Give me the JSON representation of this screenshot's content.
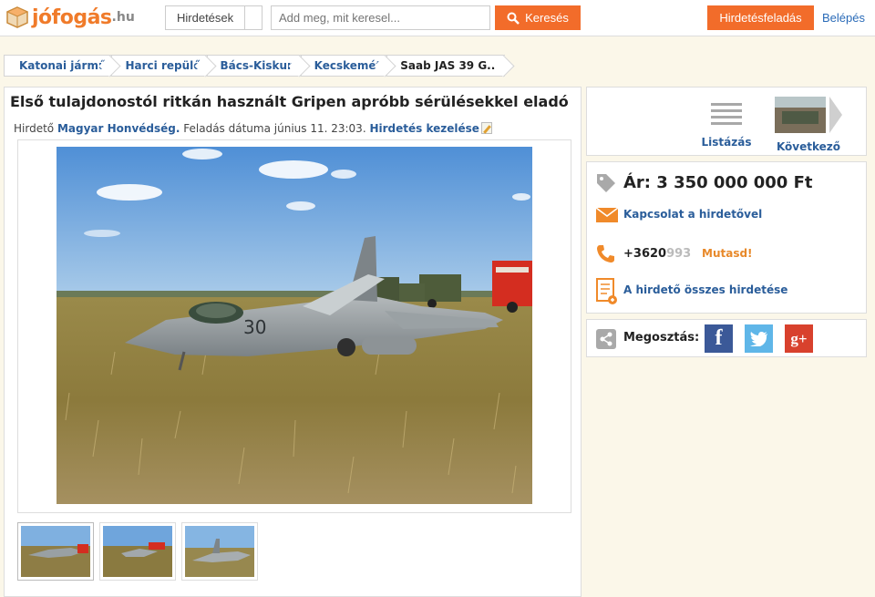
{
  "header": {
    "logo_text": "jófogás",
    "logo_tld": ".hu",
    "category_select": "Hirdetések",
    "search_placeholder": "Add meg, mit keresel...",
    "search_button": "Keresés",
    "post_button": "Hirdetésfeladás",
    "login_link": "Belépés"
  },
  "breadcrumb": [
    "Katonai jármű",
    "Harci repülő",
    "Bács-Kiskun",
    "Kecskemét",
    "Saab JAS 39 G..."
  ],
  "listing": {
    "title": "Első tulajdonostól ritkán használt Gripen apróbb sérülésekkel eladó",
    "advertiser_label": "Hirdető",
    "advertiser_name": "Magyar Honvédség.",
    "date_label": "Feladás dátuma",
    "date_value": "június 11. 23:03.",
    "manage_link": "Hirdetés kezelése",
    "main_image_alt": "Saab JAS 39 Gripen fighter jet on grass after accident",
    "thumbnail_count": 3
  },
  "sidebar": {
    "list_label": "Listázás",
    "next_label": "Következő",
    "price_text": "Ár: 3 350 000 000 Ft",
    "contact_link": "Kapcsolat a hirdetővel",
    "phone_visible": "+3620",
    "phone_faded": "993",
    "show_button": "Mutasd!",
    "all_ads_link": "A hirdető összes hirdetése",
    "share_label": "Megosztás:",
    "share_buttons": [
      "facebook",
      "twitter",
      "google-plus"
    ]
  },
  "colors": {
    "accent": "#f26c2a",
    "link": "#2a5d9a",
    "background": "#fbf7e9"
  }
}
